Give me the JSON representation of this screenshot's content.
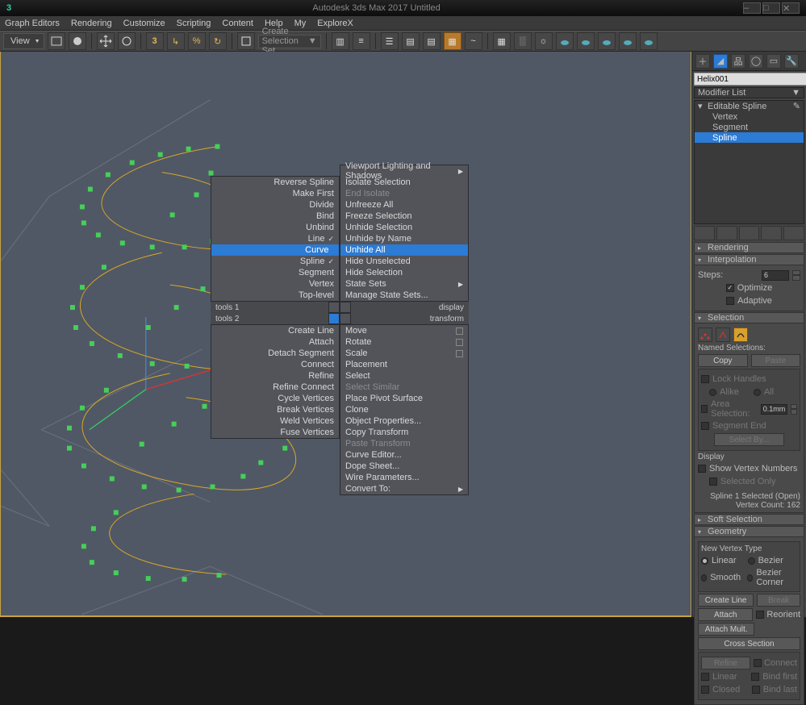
{
  "app": {
    "title": "Autodesk 3ds Max 2017    Untitled",
    "logo": "3"
  },
  "menubar": [
    "Graph Editors",
    "Rendering",
    "Customize",
    "Scripting",
    "Content",
    "Help",
    "My",
    "ExploreX"
  ],
  "toolbar": {
    "view_label": "View",
    "selection_set_ph": "Create Selection Set"
  },
  "quad_left": {
    "group1": [
      "Reverse Spline",
      "Make First",
      "Divide",
      "Bind",
      "Unbind"
    ],
    "radio": [
      {
        "t": "Line",
        "on": true
      },
      {
        "t": "Curve",
        "on": false,
        "hl": true
      },
      {
        "t": "Spline",
        "on": true
      }
    ],
    "group2": [
      "Segment",
      "Vertex",
      "Top-level"
    ],
    "hdr1": "tools 1",
    "hdr2": "tools 2",
    "group3": [
      "Create Line",
      "Attach",
      "Detach Segment",
      "Connect",
      "Refine",
      "Refine Connect",
      "Cycle Vertices",
      "Break Vertices",
      "Weld Vertices",
      "Fuse Vertices"
    ]
  },
  "quad_right": {
    "top": [
      {
        "t": "Viewport Lighting and Shadows",
        "sub": true
      },
      {
        "t": "Isolate Selection"
      },
      {
        "t": "End Isolate",
        "dim": true
      },
      {
        "t": "Unfreeze All"
      },
      {
        "t": "Freeze Selection"
      },
      {
        "t": "Unhide Selection"
      },
      {
        "t": "Unhide by Name"
      },
      {
        "t": "Unhide All",
        "hl": true
      },
      {
        "t": "Hide Unselected"
      },
      {
        "t": "Hide Selection"
      },
      {
        "t": "State Sets",
        "sub": true
      },
      {
        "t": "Manage State Sets..."
      }
    ],
    "hdr1": "display",
    "hdr2": "transform",
    "bot": [
      {
        "t": "Move",
        "box": true
      },
      {
        "t": "Rotate",
        "box": true
      },
      {
        "t": "Scale",
        "box": true
      },
      {
        "t": "Placement"
      },
      {
        "t": "Select"
      },
      {
        "t": "Select Similar",
        "dim": true
      },
      {
        "t": "Place Pivot Surface"
      },
      {
        "t": "Clone"
      },
      {
        "t": "Object Properties..."
      },
      {
        "t": "Copy Transform"
      },
      {
        "t": "Paste Transform",
        "dim": true
      },
      {
        "t": "Curve Editor..."
      },
      {
        "t": "Dope Sheet..."
      },
      {
        "t": "Wire Parameters..."
      },
      {
        "t": "Convert To:",
        "sub": true
      }
    ]
  },
  "panel": {
    "object_name": "Helix001",
    "modifier_list": "Modifier List",
    "stack": {
      "root": "Editable Spline",
      "subs": [
        "Vertex",
        "Segment",
        "Spline"
      ],
      "sel": "Spline"
    },
    "rendering_hdr": "Rendering",
    "interp": {
      "hdr": "Interpolation",
      "steps_lbl": "Steps:",
      "steps": "6",
      "optimize": "Optimize",
      "adaptive": "Adaptive"
    },
    "selection": {
      "hdr": "Selection",
      "named_lbl": "Named Selections:",
      "copy": "Copy",
      "paste": "Paste",
      "lock": "Lock Handles",
      "alike": "Alike",
      "all": "All",
      "area": "Area Selection:",
      "area_val": "0.1mm",
      "segend": "Segment End",
      "selectby": "Select By...",
      "display": "Display",
      "showvn": "Show Vertex Numbers",
      "selonly": "Selected Only",
      "status1": "Spline 1 Selected (Open)",
      "status2": "Vertex Count:  162"
    },
    "softsel_hdr": "Soft Selection",
    "geom": {
      "hdr": "Geometry",
      "nvt": "New Vertex Type",
      "linear": "Linear",
      "bezier": "Bezier",
      "smooth": "Smooth",
      "bcorner": "Bezier Corner",
      "create_line": "Create Line",
      "break": "Break",
      "attach": "Attach",
      "reorient": "Reorient",
      "attach_mult": "Attach Mult.",
      "cross": "Cross Section",
      "refine": "Refine",
      "connect": "Connect",
      "linear2": "Linear",
      "bind_first": "Bind first",
      "closed": "Closed",
      "bind_last": "Bind last"
    }
  }
}
